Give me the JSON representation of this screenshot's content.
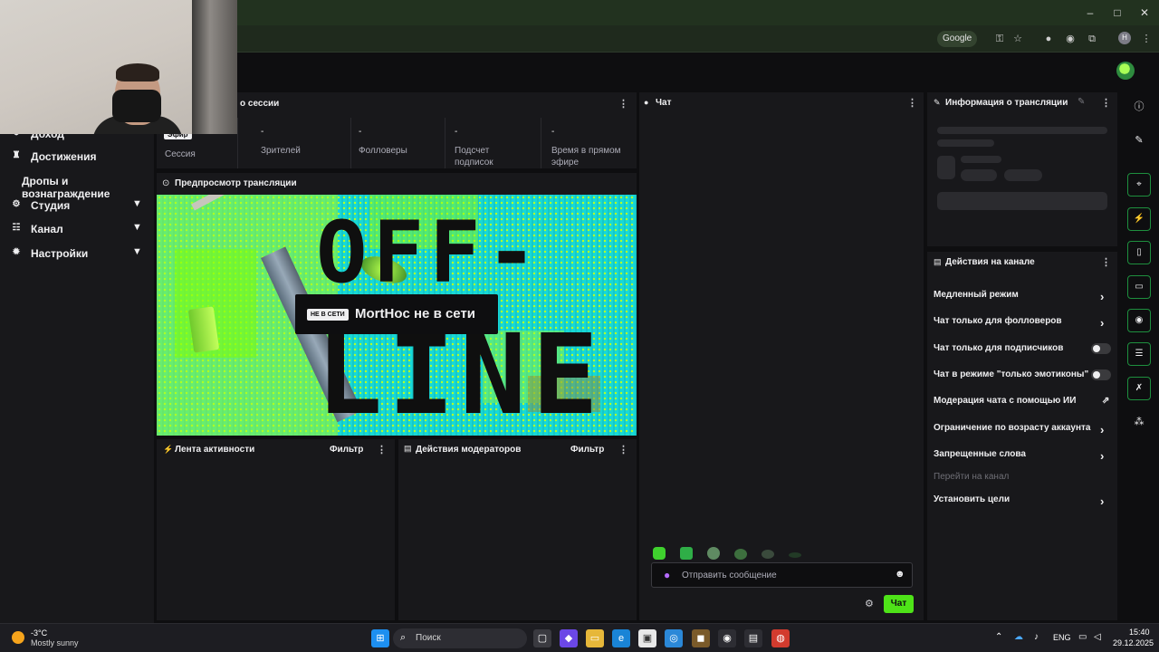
{
  "browser": {
    "search_chip": "Google",
    "profile_letter": "H"
  },
  "nav": {
    "items": [
      {
        "label": "Доход",
        "icon": "dollar-icon"
      },
      {
        "label": "Достижения",
        "icon": "trophy-icon"
      },
      {
        "label": "Дропы и вознаграждение"
      },
      {
        "label": "Студия",
        "icon": "studio-icon"
      },
      {
        "label": "Канал",
        "icon": "channel-icon"
      },
      {
        "label": "Настройки",
        "icon": "gear-icon"
      }
    ]
  },
  "session": {
    "title": "о сессии",
    "stats": [
      {
        "value": "Эфир",
        "label": "Сессия"
      },
      {
        "value": "-",
        "label": "Зрителей"
      },
      {
        "value": "-",
        "label": "Фолловеры"
      },
      {
        "value": "-",
        "label": "Подсчет подписок"
      },
      {
        "value": "-",
        "label": "Время в прямом эфире"
      }
    ]
  },
  "preview": {
    "title": "Предпросмотр трансляции",
    "off_line1": "OFF-",
    "off_line2": "LINE",
    "badge_tag": "НЕ В СЕТИ",
    "badge_text": "MortHoc не в сети"
  },
  "activity": {
    "title": "Лента активности",
    "filter": "Фильтр"
  },
  "mod_actions": {
    "title": "Действия модераторов",
    "filter": "Фильтр"
  },
  "chat": {
    "title": "Чат",
    "input_placeholder": "Отправить сообщение",
    "send_label": "Чат"
  },
  "stream_info": {
    "title": "Информация о трансляции"
  },
  "channel_actions": {
    "title": "Действия на канале",
    "rows": [
      {
        "label": "Медленный режим",
        "control": "arrow"
      },
      {
        "label": "Чат только для фолловеров",
        "control": "arrow"
      },
      {
        "label": "Чат только для подписчиков",
        "control": "toggle",
        "on": false
      },
      {
        "label": "Чат в режиме \"только эмотиконы\"",
        "control": "toggle",
        "on": false
      },
      {
        "label": "Модерация чата с помощью ИИ",
        "control": "external"
      },
      {
        "label": "Ограничение по возрасту аккаунта",
        "control": "arrow"
      },
      {
        "label": "Запрещенные слова",
        "control": "arrow"
      },
      {
        "label": "Перейти на канал",
        "control": "none",
        "muted": true
      },
      {
        "label": "Установить цели",
        "control": "arrow"
      }
    ]
  },
  "taskbar": {
    "weather_temp": "-3°C",
    "weather_desc": "Mostly sunny",
    "search_label": "Поиск",
    "lang": "ENG",
    "time": "15:40",
    "date": "29.12.2025"
  },
  "colors": {
    "accent": "#4ee318",
    "panel": "#18181b",
    "background": "#0e0e10"
  }
}
